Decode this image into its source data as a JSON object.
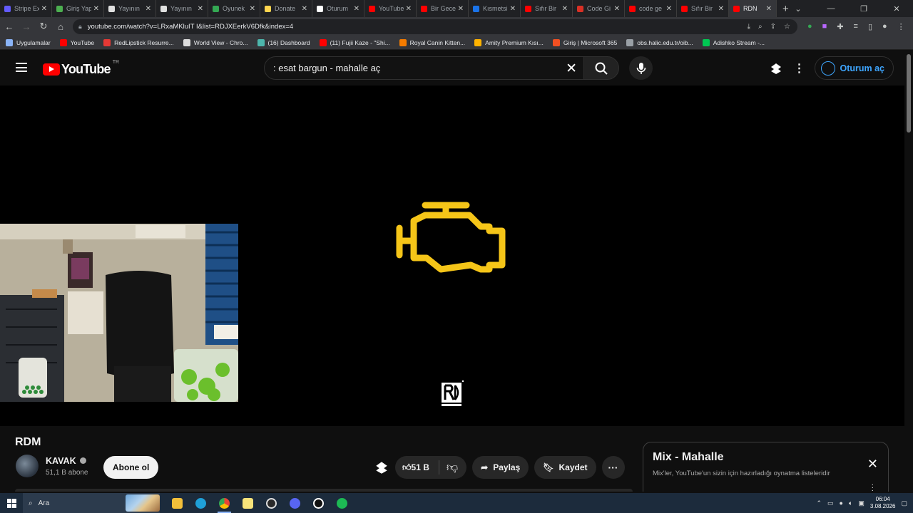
{
  "browser": {
    "tabs": [
      {
        "label": "Stripe Ex",
        "color": "#635bff"
      },
      {
        "label": "Giriş Yap",
        "color": "#4caf50"
      },
      {
        "label": "Yayının",
        "color": "#e0e0e0"
      },
      {
        "label": "Yayının",
        "color": "#e0e0e0"
      },
      {
        "label": "Oyunek",
        "color": "#34a853"
      },
      {
        "label": "Donate",
        "color": "#ffd54f"
      },
      {
        "label": "Oturum",
        "color": "#ffffff"
      },
      {
        "label": "YouTube",
        "color": "#ff0000"
      },
      {
        "label": "Bir Gece",
        "color": "#ff0000"
      },
      {
        "label": "Kısmetsi",
        "color": "#1a73e8"
      },
      {
        "label": "Sıfır Bir",
        "color": "#ff0000"
      },
      {
        "label": "Code Gi",
        "color": "#d93025"
      },
      {
        "label": "code ge",
        "color": "#ff0000"
      },
      {
        "label": "Sıfır Bir",
        "color": "#ff0000"
      },
      {
        "label": "RDN",
        "color": "#ff0000",
        "active": true
      }
    ],
    "new_tab": "+",
    "url": "youtube.com/watch?v=LRxaMKluIT I&list=RDJXEerkV6Dfk&index=4",
    "bookmarks": [
      {
        "label": "Uygulamalar",
        "color": "#8ab4f8"
      },
      {
        "label": "YouTube",
        "color": "#ff0000"
      },
      {
        "label": "RedLipstick Resurre...",
        "color": "#e53935"
      },
      {
        "label": "World View - Chro...",
        "color": "#dddddd"
      },
      {
        "label": "(16) Dashboard",
        "color": "#4db6ac"
      },
      {
        "label": "(11) Fujii Kaze - \"Shi...",
        "color": "#ff0000"
      },
      {
        "label": "Royal Canin Kitten...",
        "color": "#f57c00"
      },
      {
        "label": "Amity Premium Kısı...",
        "color": "#ffb300"
      },
      {
        "label": "Giriş | Microsoft 365",
        "color": "#f25022"
      },
      {
        "label": "obs.halic.edu.tr/oib...",
        "color": "#9aa0a6"
      },
      {
        "label": "Adishko Stream -...",
        "color": "#00c853"
      }
    ]
  },
  "youtube": {
    "logo_text": "YouTube",
    "country": "TR",
    "search_value": ": esat bargun - mahalle aç",
    "signin_label": "Oturum aç"
  },
  "video": {
    "title": "RDM",
    "channel": "KAVAK",
    "subscribers": "51,1 B abone",
    "subscribe_label": "Abone ol",
    "likes": "51 B",
    "share_label": "Paylaş",
    "save_label": "Kaydet",
    "check_engine_color": "#f5c518"
  },
  "mix": {
    "title": "Mix - Mahalle",
    "subtitle": "Mix'ler, YouTube'un sizin için hazırladığı oynatma listeleridir"
  },
  "taskbar": {
    "search_label": "Ara",
    "time": "06:04",
    "date": "3.08.2026"
  }
}
